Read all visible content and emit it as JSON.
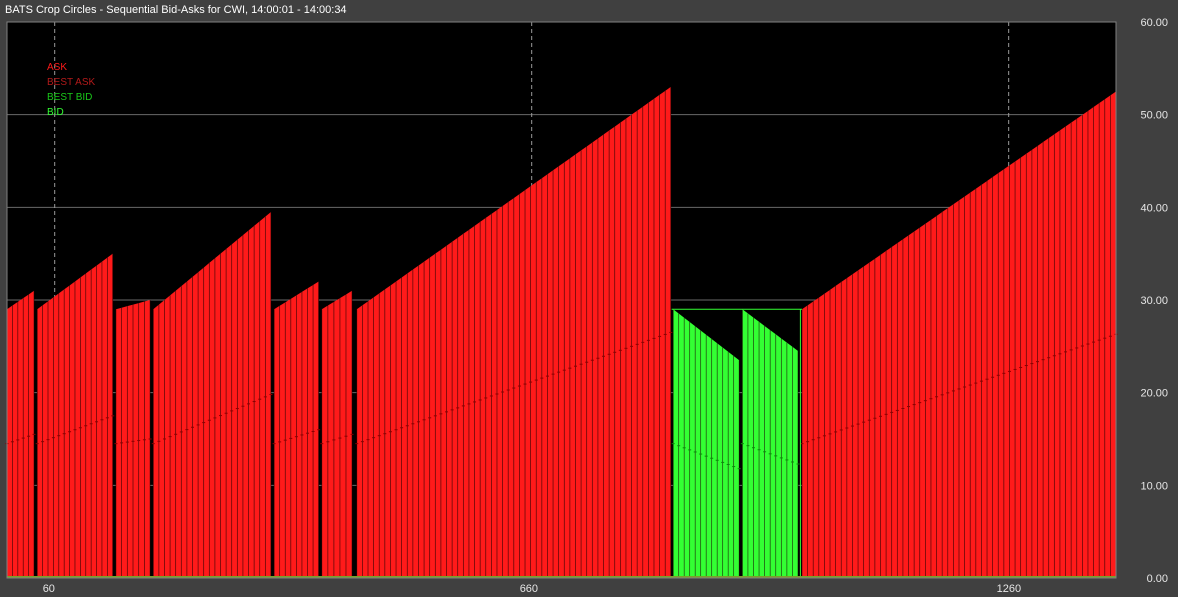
{
  "window": {
    "title": "BATS Crop Circles - Sequential Bid-Asks for CWI, 14:00:01 - 14:00:34"
  },
  "chart_data": {
    "type": "bar",
    "xlabel": "",
    "ylabel": "",
    "ylim": [
      0,
      60
    ],
    "xlim": [
      0,
      1395
    ],
    "x_ticks": [
      {
        "value": 60,
        "label": "60"
      },
      {
        "value": 660,
        "label": "660"
      },
      {
        "value": 1260,
        "label": "1260"
      }
    ],
    "y_ticks": [
      {
        "value": 0,
        "label": "0.00"
      },
      {
        "value": 10,
        "label": "10.00"
      },
      {
        "value": 20,
        "label": "20.00"
      },
      {
        "value": 30,
        "label": "30.00"
      },
      {
        "value": 40,
        "label": "40.00"
      },
      {
        "value": 50,
        "label": "50.00"
      },
      {
        "value": 60,
        "label": "60.00"
      }
    ],
    "grid": true,
    "legend_position": "top-left",
    "legend": [
      {
        "name": "ASK",
        "color": "#ff1a1a"
      },
      {
        "name": "BEST ASK",
        "color": "#b31a1a"
      },
      {
        "name": "BEST BID",
        "color": "#1ac81a"
      },
      {
        "name": "BID",
        "color": "#33ff33"
      }
    ],
    "best_level_line": 29,
    "bar_spacing": 7,
    "segments": [
      {
        "series": "ASK",
        "x_start": 0,
        "x_end": 34,
        "y_start": 29,
        "y_end": 31,
        "inner_start": 14.5,
        "inner_end": 15.5
      },
      {
        "series": "ASK",
        "x_start": 38,
        "x_end": 133,
        "y_start": 29,
        "y_end": 35,
        "inner_start": 14.5,
        "inner_end": 17.5
      },
      {
        "series": "ASK",
        "x_start": 137,
        "x_end": 180,
        "y_start": 29,
        "y_end": 30,
        "inner_start": 14.5,
        "inner_end": 15
      },
      {
        "series": "ASK",
        "x_start": 184,
        "x_end": 332,
        "y_start": 29,
        "y_end": 39.5,
        "inner_start": 14.5,
        "inner_end": 19.8
      },
      {
        "series": "ASK",
        "x_start": 336,
        "x_end": 392,
        "y_start": 29,
        "y_end": 32,
        "inner_start": 14.5,
        "inner_end": 16
      },
      {
        "series": "ASK",
        "x_start": 396,
        "x_end": 434,
        "y_start": 29,
        "y_end": 31,
        "inner_start": 14.5,
        "inner_end": 15.5
      },
      {
        "series": "ASK",
        "x_start": 440,
        "x_end": 835,
        "y_start": 29,
        "y_end": 53,
        "inner_start": 14.5,
        "inner_end": 26.5
      },
      {
        "series": "BID",
        "x_start": 838,
        "x_end": 921,
        "y_start": 29,
        "y_end": 23.5,
        "inner_start": 14.5,
        "inner_end": 11.8
      },
      {
        "series": "BID",
        "x_start": 925,
        "x_end": 995,
        "y_start": 29,
        "y_end": 24.5,
        "inner_start": 14.5,
        "inner_end": 12.3
      },
      {
        "series": "ASK",
        "x_start": 1000,
        "x_end": 1395,
        "y_start": 29,
        "y_end": 52.5,
        "inner_start": 14.5,
        "inner_end": 26.3
      }
    ]
  }
}
